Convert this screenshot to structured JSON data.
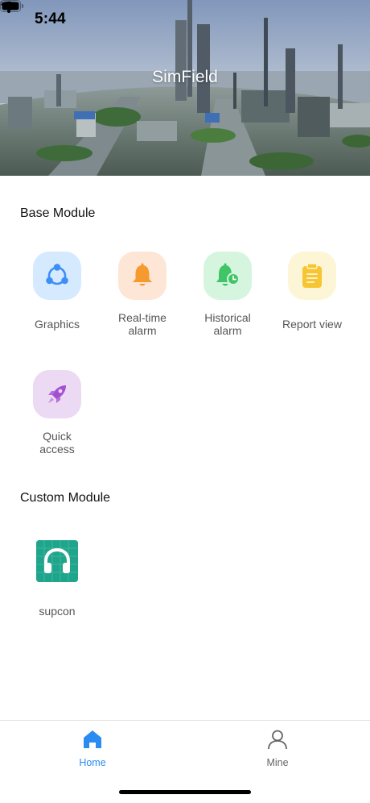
{
  "status_bar": {
    "time": "5:44"
  },
  "header": {
    "title": "SimField"
  },
  "base_module": {
    "title": "Base Module",
    "items": [
      {
        "label": "Graphics",
        "icon": "share-nodes-icon",
        "tile_color": "#d6eaff",
        "icon_color": "#3d8ef5"
      },
      {
        "label": "Real-time alarm",
        "icon": "bell-icon",
        "tile_color": "#fde6d5",
        "icon_color": "#f59a2f"
      },
      {
        "label": "Historical alarm",
        "icon": "bell-clock-icon",
        "tile_color": "#d6f5de",
        "icon_color": "#3fc466"
      },
      {
        "label": "Report view",
        "icon": "clipboard-icon",
        "tile_color": "#fdf6d6",
        "icon_color": "#f7c531"
      },
      {
        "label": "Quick access",
        "icon": "rocket-icon",
        "tile_color": "#ecd9f3",
        "icon_color": "#a24fd0"
      }
    ]
  },
  "custom_module": {
    "title": "Custom Module",
    "items": [
      {
        "label": "supcon",
        "icon": "headphones-icon",
        "tile_color": "#1fa58c"
      }
    ]
  },
  "tabbar": {
    "tabs": [
      {
        "label": "Home",
        "icon": "home-icon",
        "active": true,
        "color": "#2a8cf0"
      },
      {
        "label": "Mine",
        "icon": "user-icon",
        "active": false,
        "color": "#666666"
      }
    ]
  }
}
